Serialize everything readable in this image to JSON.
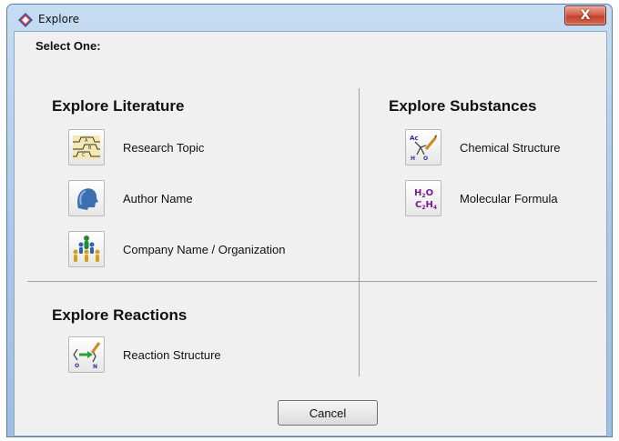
{
  "window": {
    "title": "Explore",
    "close_label": "X"
  },
  "prompt": "Select One:",
  "sections": {
    "literature": {
      "title": "Explore Literature",
      "items": [
        {
          "label": "Research Topic",
          "icon": "research-topic-icon"
        },
        {
          "label": "Author Name",
          "icon": "author-head-icon"
        },
        {
          "label": "Company Name / Organization",
          "icon": "organization-people-icon"
        }
      ]
    },
    "substances": {
      "title": "Explore Substances",
      "items": [
        {
          "label": "Chemical Structure",
          "icon": "chemical-structure-icon",
          "glyph_texts": [
            "Ac",
            "H",
            "O"
          ]
        },
        {
          "label": "Molecular Formula",
          "icon": "molecular-formula-icon",
          "glyph_texts": [
            "H",
            "2",
            "O",
            "C",
            "2",
            "H",
            "4"
          ]
        }
      ]
    },
    "reactions": {
      "title": "Explore Reactions",
      "items": [
        {
          "label": "Reaction Structure",
          "icon": "reaction-structure-icon",
          "glyph_texts": [
            "O",
            "N"
          ]
        }
      ]
    }
  },
  "cancel_label": "Cancel",
  "colors": {
    "formula_purple": "#7a1d8f",
    "reaction_green": "#2f9e3a",
    "author_blue": "#3b6fb0",
    "close_red": "#c9432f"
  }
}
